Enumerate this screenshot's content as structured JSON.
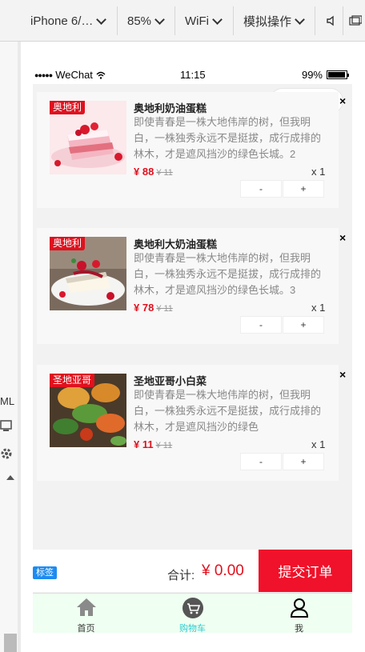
{
  "toolbar": {
    "device": "iPhone 6/…",
    "zoom": "85%",
    "network": "WiFi",
    "simulate": "模拟操作"
  },
  "side": {
    "label": "ML"
  },
  "status": {
    "signal": "●●●●●",
    "carrier": "WeChat",
    "time": "11:15",
    "battery": "99%"
  },
  "products": [
    {
      "tag": "奥地利",
      "title": "奥地利奶油蛋糕",
      "desc": "即使青春是一株大地伟岸的树，但我明白，一株独秀永远不是挺拔，成行成排的林木，才是遮风挡沙的绿色长城。2",
      "price": "¥ 88",
      "old_price": "¥ 11",
      "qty": "x 1",
      "minus": "-",
      "plus": "+",
      "close": "×",
      "image": "strawberry-cake"
    },
    {
      "tag": "奥地利",
      "title": "奥地利大奶油蛋糕",
      "desc": "即使青春是一株大地伟岸的树，但我明白，一株独秀永远不是挺拔，成行成排的林木，才是遮风挡沙的绿色长城。3",
      "price": "¥ 78",
      "old_price": "¥ 11",
      "qty": "x 1",
      "minus": "-",
      "plus": "+",
      "close": "×",
      "image": "cheesecake"
    },
    {
      "tag": "圣地亚哥",
      "title": "圣地亚哥小白菜",
      "desc": "即使青春是一株大地伟岸的树，但我明白，一株独秀永远不是挺拔，成行成排的林木，才是遮风挡沙的绿色",
      "price": "¥ 11",
      "old_price": "¥ 11",
      "qty": "x 1",
      "minus": "-",
      "plus": "+",
      "close": "×",
      "image": "vegetables"
    }
  ],
  "checkout": {
    "badge": "标签",
    "total_label": "合计:",
    "total_value": "¥ 0.00",
    "submit": "提交订单"
  },
  "tabs": [
    {
      "label": "首页",
      "icon": "home-icon"
    },
    {
      "label": "购物车",
      "icon": "cart-icon",
      "active": true
    },
    {
      "label": "我",
      "icon": "user-icon"
    }
  ],
  "colors": {
    "accent": "#e0111e",
    "active_tab": "#2ecbd0",
    "tabbar_bg": "#effff1"
  }
}
